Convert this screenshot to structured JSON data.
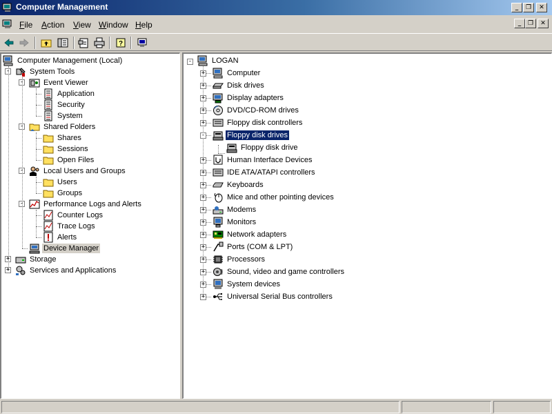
{
  "window": {
    "title": "Computer Management"
  },
  "caption_buttons": {
    "minimize": "_",
    "restore": "❐",
    "close": "✕"
  },
  "menu": [
    {
      "label": "File",
      "u": "F",
      "rest": "ile"
    },
    {
      "label": "Action",
      "u": "A",
      "rest": "ction"
    },
    {
      "label": "View",
      "u": "V",
      "rest": "iew"
    },
    {
      "label": "Window",
      "u": "W",
      "rest": "indow"
    },
    {
      "label": "Help",
      "u": "H",
      "rest": "elp"
    }
  ],
  "left_tree": [
    {
      "label": "Computer Management (Local)",
      "icon": "computer-icon"
    },
    {
      "label": "System Tools",
      "icon": "tools-icon"
    },
    {
      "label": "Event Viewer",
      "icon": "event-viewer-icon"
    },
    {
      "label": "Application",
      "icon": "log-icon"
    },
    {
      "label": "Security",
      "icon": "log-icon"
    },
    {
      "label": "System",
      "icon": "log-icon"
    },
    {
      "label": "Shared Folders",
      "icon": "shared-folder-icon"
    },
    {
      "label": "Shares",
      "icon": "folder-icon"
    },
    {
      "label": "Sessions",
      "icon": "folder-icon"
    },
    {
      "label": "Open Files",
      "icon": "folder-icon"
    },
    {
      "label": "Local Users and Groups",
      "icon": "users-icon"
    },
    {
      "label": "Users",
      "icon": "folder-icon"
    },
    {
      "label": "Groups",
      "icon": "folder-icon"
    },
    {
      "label": "Performance Logs and Alerts",
      "icon": "performance-icon"
    },
    {
      "label": "Counter Logs",
      "icon": "chart-log-icon"
    },
    {
      "label": "Trace Logs",
      "icon": "chart-log-icon"
    },
    {
      "label": "Alerts",
      "icon": "alert-icon"
    },
    {
      "label": "Device Manager",
      "icon": "device-manager-icon"
    },
    {
      "label": "Storage",
      "icon": "storage-icon"
    },
    {
      "label": "Services and Applications",
      "icon": "services-icon"
    }
  ],
  "right_tree": {
    "root": {
      "label": "LOGAN",
      "icon": "computer-icon"
    },
    "categories": [
      {
        "label": "Computer",
        "icon": "computer-icon"
      },
      {
        "label": "Disk drives",
        "icon": "disk-drive-icon"
      },
      {
        "label": "Display adapters",
        "icon": "display-adapter-icon"
      },
      {
        "label": "DVD/CD-ROM drives",
        "icon": "cdrom-icon"
      },
      {
        "label": "Floppy disk controllers",
        "icon": "controller-icon"
      },
      {
        "label": "Floppy disk drives",
        "icon": "floppy-drive-icon"
      },
      {
        "label": "Floppy disk drive",
        "icon": "floppy-drive-icon"
      },
      {
        "label": "Human Interface Devices",
        "icon": "hid-icon"
      },
      {
        "label": "IDE ATA/ATAPI controllers",
        "icon": "controller-icon"
      },
      {
        "label": "Keyboards",
        "icon": "keyboard-icon"
      },
      {
        "label": "Mice and other pointing devices",
        "icon": "mouse-icon"
      },
      {
        "label": "Modems",
        "icon": "modem-icon"
      },
      {
        "label": "Monitors",
        "icon": "monitor-icon"
      },
      {
        "label": "Network adapters",
        "icon": "network-adapter-icon"
      },
      {
        "label": "Ports (COM & LPT)",
        "icon": "port-icon"
      },
      {
        "label": "Processors",
        "icon": "processor-icon"
      },
      {
        "label": "Sound, video and game controllers",
        "icon": "sound-icon"
      },
      {
        "label": "System devices",
        "icon": "system-device-icon"
      },
      {
        "label": "Universal Serial Bus controllers",
        "icon": "usb-icon"
      }
    ]
  },
  "colors": {
    "title_start": "#0a246a",
    "title_end": "#a6caf0",
    "selection": "#0a246a",
    "face": "#d4d0c8"
  }
}
